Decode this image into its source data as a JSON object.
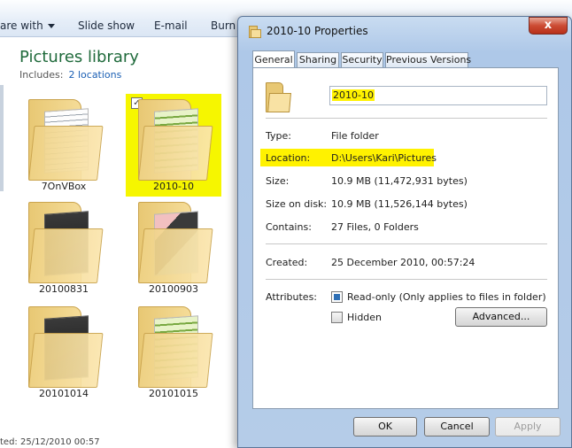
{
  "toolbar": {
    "share_with": "are with",
    "slide_show": "Slide show",
    "email": "E-mail",
    "burn": "Burn"
  },
  "library": {
    "title": "Pictures library",
    "includes_label": "Includes:",
    "locations_link": "2 locations"
  },
  "folders": [
    {
      "name": "7OnVBox",
      "selected": false
    },
    {
      "name": "2010-10",
      "selected": true
    },
    {
      "name": "20100831",
      "selected": false
    },
    {
      "name": "20100903",
      "selected": false
    },
    {
      "name": "20101014",
      "selected": false
    },
    {
      "name": "20101015",
      "selected": false
    }
  ],
  "statusbar": {
    "text": "ted: 25/12/2010 00:57"
  },
  "dialog": {
    "title": "2010-10 Properties",
    "close_glyph": "x",
    "tabs": [
      "General",
      "Sharing",
      "Security",
      "Previous Versions"
    ],
    "active_tab": "General",
    "name_value": "2010-10",
    "type_label": "Type:",
    "type_value": "File folder",
    "location_label": "Location:",
    "location_value": "D:\\Users\\Kari\\Pictures",
    "size_label": "Size:",
    "size_value": "10.9 MB (11,472,931 bytes)",
    "size_on_disk_label": "Size on disk:",
    "size_on_disk_value": "10.9 MB (11,526,144 bytes)",
    "contains_label": "Contains:",
    "contains_value": "27 Files, 0 Folders",
    "created_label": "Created:",
    "created_value": "25 December 2010, 00:57:24",
    "attributes_label": "Attributes:",
    "readonly_label": "Read-only (Only applies to files in folder)",
    "readonly_checked": true,
    "hidden_label": "Hidden",
    "hidden_checked": false,
    "advanced_button": "Advanced...",
    "ok_button": "OK",
    "cancel_button": "Cancel",
    "apply_button": "Apply",
    "highlight_color": "#fff200"
  }
}
